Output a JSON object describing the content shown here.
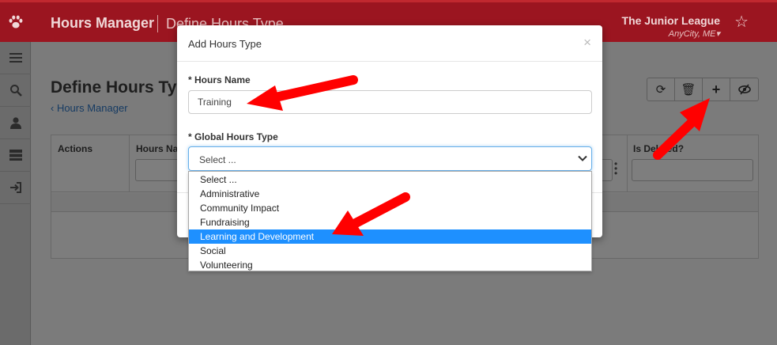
{
  "header": {
    "app_title": "Hours Manager",
    "page_subtitle": "Define Hours Type",
    "org_name": "The Junior League",
    "org_city": "AnyCity, ME▾"
  },
  "sidebar": {
    "items": [
      {
        "icon": "menu-icon"
      },
      {
        "icon": "search-icon"
      },
      {
        "icon": "user-icon"
      },
      {
        "icon": "server-icon"
      },
      {
        "icon": "sign-in-icon"
      }
    ]
  },
  "main": {
    "title": "Define Hours Type",
    "back_link": "‹ Hours Manager",
    "toolbar": [
      "refresh-icon",
      "trash-icon",
      "plus-icon",
      "eye-slash-icon"
    ],
    "columns": {
      "actions": "Actions",
      "hours_name": "Hours Name",
      "is_deleted": "Is Deleted?"
    }
  },
  "modal": {
    "title": "Add Hours Type",
    "close": "×",
    "hours_name_label": "* Hours Name",
    "hours_name_value": "Training",
    "global_type_label": "* Global Hours Type",
    "global_type_value": "Select ..."
  },
  "dropdown": {
    "options": [
      "Select ...",
      "Administrative",
      "Community Impact",
      "Fundraising",
      "Learning and Development",
      "Social",
      "Volunteering"
    ],
    "highlighted": "Learning and Development"
  },
  "colors": {
    "brand": "#9b1520",
    "highlight": "#1e90ff",
    "annotation_arrow": "#ff0000"
  }
}
